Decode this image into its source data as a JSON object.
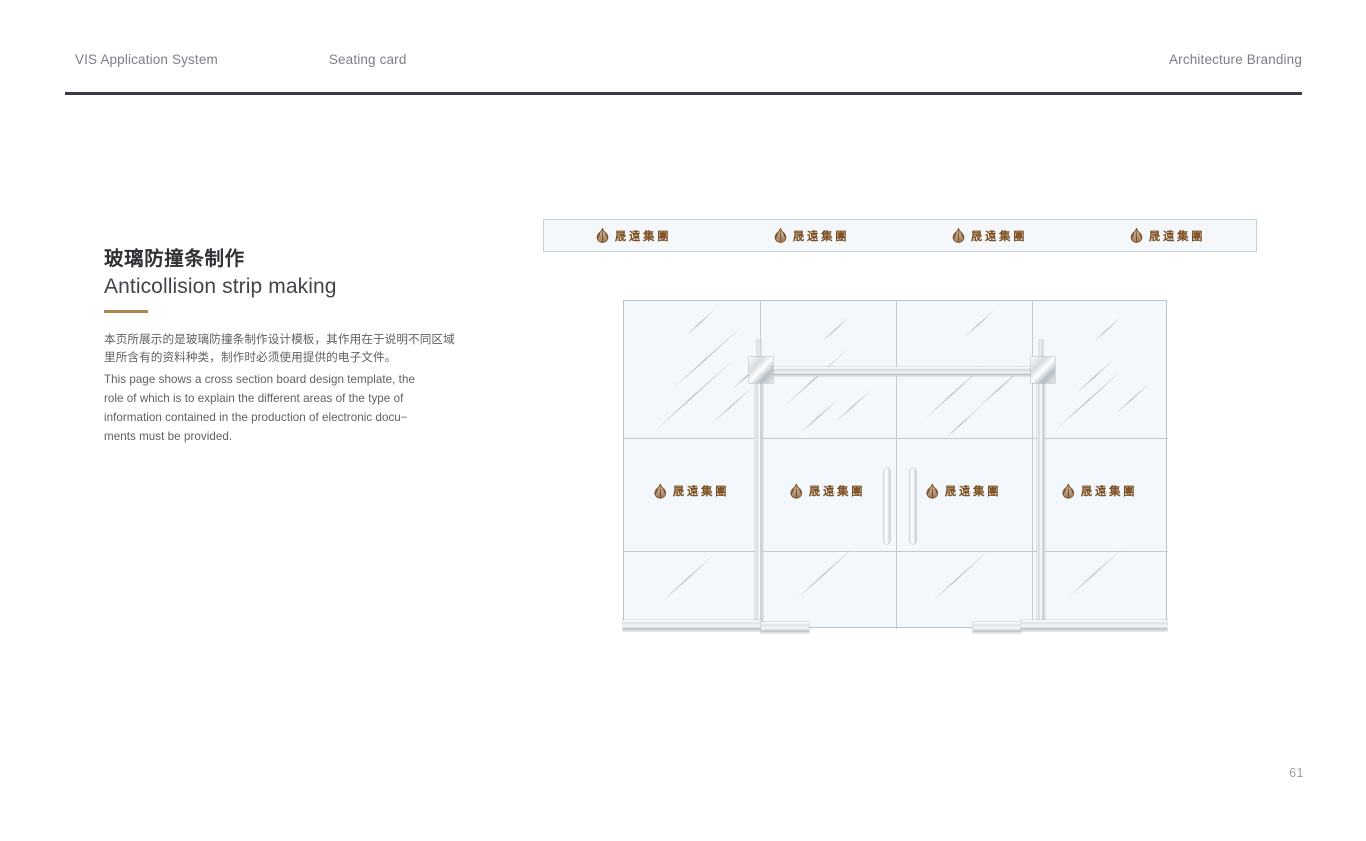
{
  "header": {
    "left_items": [
      {
        "label": "VIS Application System"
      },
      {
        "label": "Seating card"
      }
    ],
    "right_label": "Architecture Branding"
  },
  "content": {
    "title_cn": "玻璃防撞条制作",
    "title_en": "Anticollision strip making",
    "body_cn_line1": "本页所展示的是玻璃防撞条制作设计模板，其作用在于说明不同区域",
    "body_cn_line2": "里所含有的资料种类，制作时必须使用提供的电子文件。",
    "body_en_line1": "This page shows a cross section board design template, the",
    "body_en_line2": "role of which is to explain the different areas of the type of",
    "body_en_line3": "information contained in the production of electronic docu−",
    "body_en_line4": "ments must be provided."
  },
  "brand": {
    "logo_text": "晟遠集團",
    "logo_mark_name": "shengyuan-group-emblem",
    "logo_color": "#7d4f22",
    "accent_color": "#b1854c"
  },
  "strip": {
    "name": "anticollision-strip-sample",
    "background": "#f4f8fb",
    "border_color": "#c9d2d8",
    "logo_count": 4
  },
  "door": {
    "name": "glass-door-elevation",
    "glass_color": "#f2f8fb",
    "frame_color": "#c2ccd3",
    "panel_columns": 4,
    "panel_rows": 3,
    "logo_count": 4,
    "handle_count": 2
  },
  "footer": {
    "page_number": "61"
  }
}
